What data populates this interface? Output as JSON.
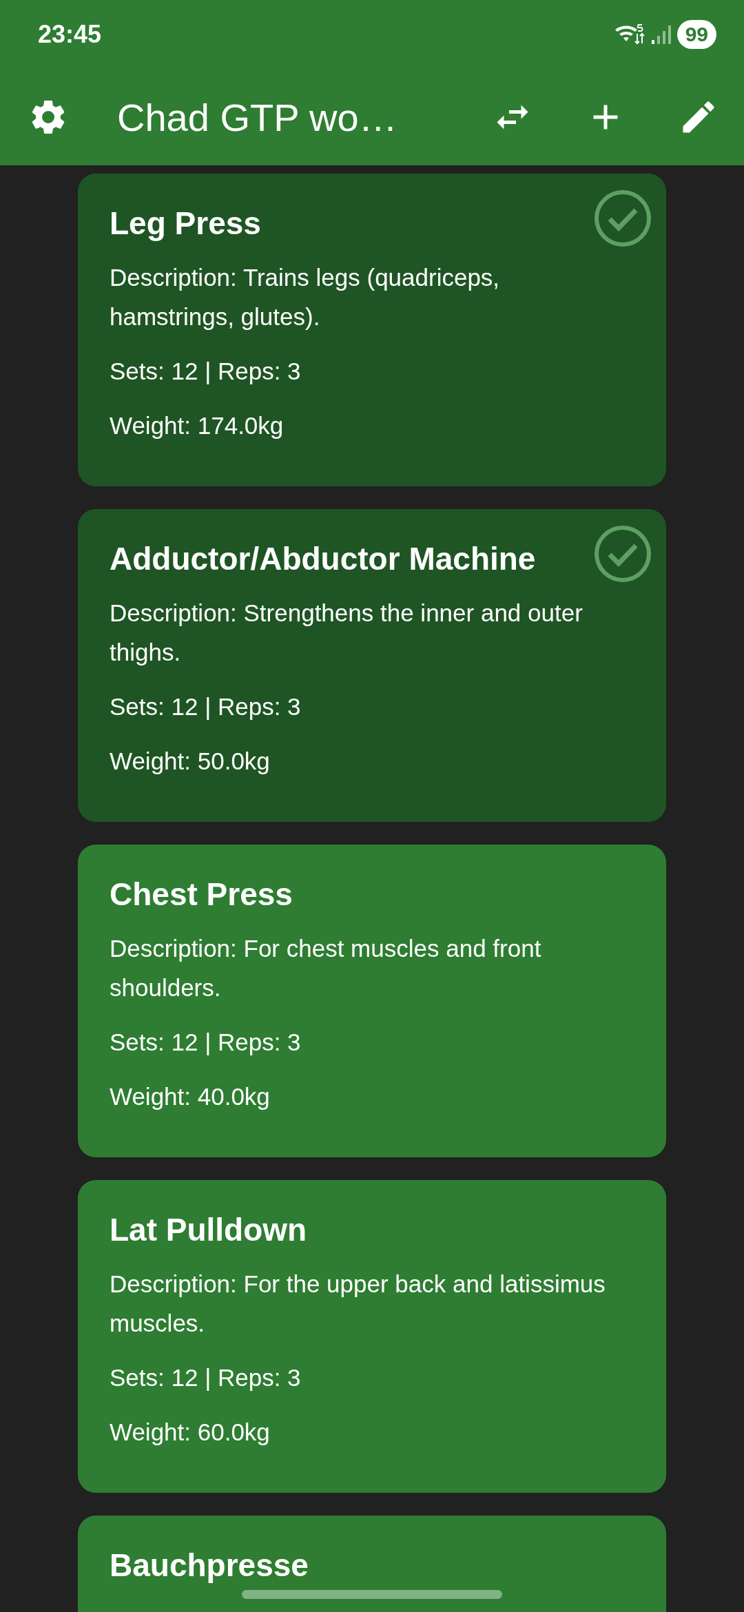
{
  "status_bar": {
    "time": "23:45",
    "battery": "99"
  },
  "app_bar": {
    "title": "Chad GTP wo…"
  },
  "exercises": [
    {
      "name": "Leg Press",
      "description": "Description: Trains legs (quadriceps, hamstrings, glutes).",
      "sets_reps": "Sets: 12 | Reps: 3",
      "weight": "Weight: 174.0kg",
      "completed": true
    },
    {
      "name": "Adductor/Abductor Machine",
      "description": "Description: Strengthens the inner and outer thighs.",
      "sets_reps": "Sets: 12 | Reps: 3",
      "weight": "Weight: 50.0kg",
      "completed": true
    },
    {
      "name": "Chest Press",
      "description": "Description: For chest muscles and front shoulders.",
      "sets_reps": "Sets: 12 | Reps: 3",
      "weight": "Weight: 40.0kg",
      "completed": false
    },
    {
      "name": "Lat Pulldown",
      "description": "Description: For the upper back and latissimus muscles.",
      "sets_reps": "Sets: 12 | Reps: 3",
      "weight": "Weight: 60.0kg",
      "completed": false
    },
    {
      "name": "Bauchpresse",
      "completed": false
    }
  ]
}
